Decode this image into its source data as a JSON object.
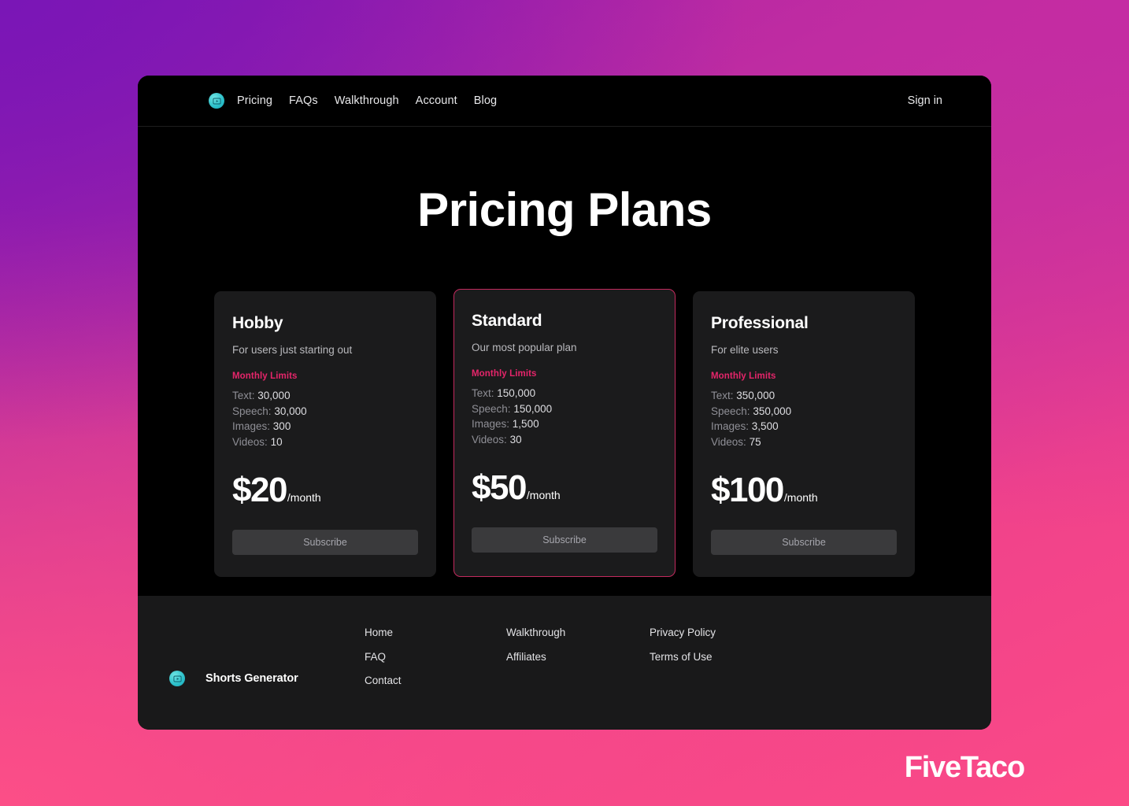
{
  "header": {
    "logo_icon": "video-play-circle-icon",
    "nav": [
      {
        "label": "Pricing"
      },
      {
        "label": "FAQs"
      },
      {
        "label": "Walkthrough"
      },
      {
        "label": "Account"
      },
      {
        "label": "Blog"
      }
    ],
    "signin_label": "Sign in"
  },
  "main": {
    "title": "Pricing Plans",
    "limits_heading": "Monthly Limits",
    "period_suffix": "/month",
    "subscribe_label": "Subscribe",
    "plans": [
      {
        "name": "Hobby",
        "tagline": "For users just starting out",
        "featured": false,
        "price": "$20",
        "period": "/month",
        "limits": [
          {
            "label": "Text:",
            "value": "30,000"
          },
          {
            "label": "Speech:",
            "value": "30,000"
          },
          {
            "label": "Images:",
            "value": "300"
          },
          {
            "label": "Videos:",
            "value": "10"
          }
        ],
        "cta": "Subscribe"
      },
      {
        "name": "Standard",
        "tagline": "Our most popular plan",
        "featured": true,
        "price": "$50",
        "period": "/month",
        "limits": [
          {
            "label": "Text:",
            "value": "150,000"
          },
          {
            "label": "Speech:",
            "value": "150,000"
          },
          {
            "label": "Images:",
            "value": "1,500"
          },
          {
            "label": "Videos:",
            "value": "30"
          }
        ],
        "cta": "Subscribe"
      },
      {
        "name": "Professional",
        "tagline": "For elite users",
        "featured": false,
        "price": "$100",
        "period": "/month",
        "limits": [
          {
            "label": "Text:",
            "value": "350,000"
          },
          {
            "label": "Speech:",
            "value": "350,000"
          },
          {
            "label": "Images:",
            "value": "3,500"
          },
          {
            "label": "Videos:",
            "value": "75"
          }
        ],
        "cta": "Subscribe"
      }
    ]
  },
  "footer": {
    "logo_icon": "video-play-circle-icon",
    "brand_name": "Shorts Generator",
    "columns": [
      {
        "links": [
          {
            "label": "Home"
          },
          {
            "label": "FAQ"
          },
          {
            "label": "Contact"
          }
        ]
      },
      {
        "links": [
          {
            "label": "Walkthrough"
          },
          {
            "label": "Affiliates"
          }
        ]
      },
      {
        "links": [
          {
            "label": "Privacy Policy"
          },
          {
            "label": "Terms of Use"
          }
        ]
      }
    ]
  },
  "watermark": {
    "text": "FiveTaco"
  },
  "colors": {
    "accent_pink": "#e5256a",
    "featured_border": "#c32a5e",
    "logo_teal": "#2bbfc9",
    "card_bg": "#1b1b1c",
    "page_bg": "#000000",
    "footer_bg": "#19191a",
    "button_bg": "#3a3a3c"
  }
}
